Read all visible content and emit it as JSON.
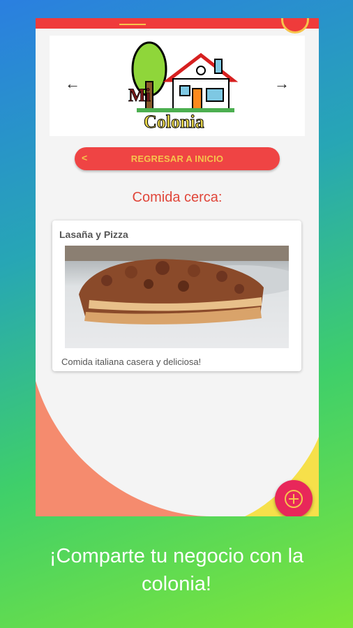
{
  "header": {
    "prev_arrow": "←",
    "next_arrow": "→",
    "logo_word_1": "Mi",
    "logo_word_2": "Colonia"
  },
  "back_button": {
    "chevron": "<",
    "label": "REGRESAR A INICIO"
  },
  "section_title": "Comida cerca:",
  "listing": {
    "title": "Lasaña y Pizza",
    "description": "Comida italiana casera y deliciosa!"
  },
  "caption": {
    "line1": "¡Comparte tu negocio con la",
    "line2": "colonia!"
  },
  "colors": {
    "accent_red": "#ef4444",
    "accent_yellow": "#f6c44c",
    "fab_pink": "#e8275a",
    "wave_coral": "#f58b6e"
  },
  "icons": {
    "prev": "arrow-left-icon",
    "next": "arrow-right-icon",
    "fab": "add-circle-icon"
  }
}
